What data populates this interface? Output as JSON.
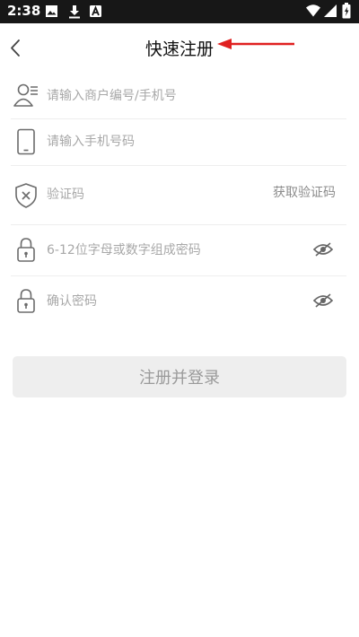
{
  "status_bar": {
    "time": "2:38",
    "icons": [
      "image-icon",
      "download-icon",
      "a-notification-icon",
      "wifi-icon",
      "signal-icon",
      "battery-icon"
    ]
  },
  "header": {
    "back_icon": "chevron-left-icon",
    "title": "快速注册",
    "annotation_color": "#e02020"
  },
  "form": {
    "account": {
      "icon": "user-list-icon",
      "placeholder": "请输入商户编号/手机号",
      "value": ""
    },
    "phone": {
      "icon": "phone-icon",
      "placeholder": "请输入手机号码",
      "value": ""
    },
    "code": {
      "icon": "shield-x-icon",
      "placeholder": "验证码",
      "value": "",
      "get_code_label": "获取验证码"
    },
    "password": {
      "icon": "lock-icon",
      "placeholder": "6-12位字母或数字组成密码",
      "value": "",
      "toggle_icon": "eye-hidden-icon"
    },
    "confirm": {
      "icon": "lock-icon",
      "placeholder": "确认密码",
      "value": "",
      "toggle_icon": "eye-hidden-icon"
    }
  },
  "submit_label": "注册并登录",
  "colors": {
    "status_bar_bg": "#171717",
    "icon_color": "#6b6b6b",
    "button_bg": "#eeeeee",
    "button_text": "#9a9a9a"
  }
}
